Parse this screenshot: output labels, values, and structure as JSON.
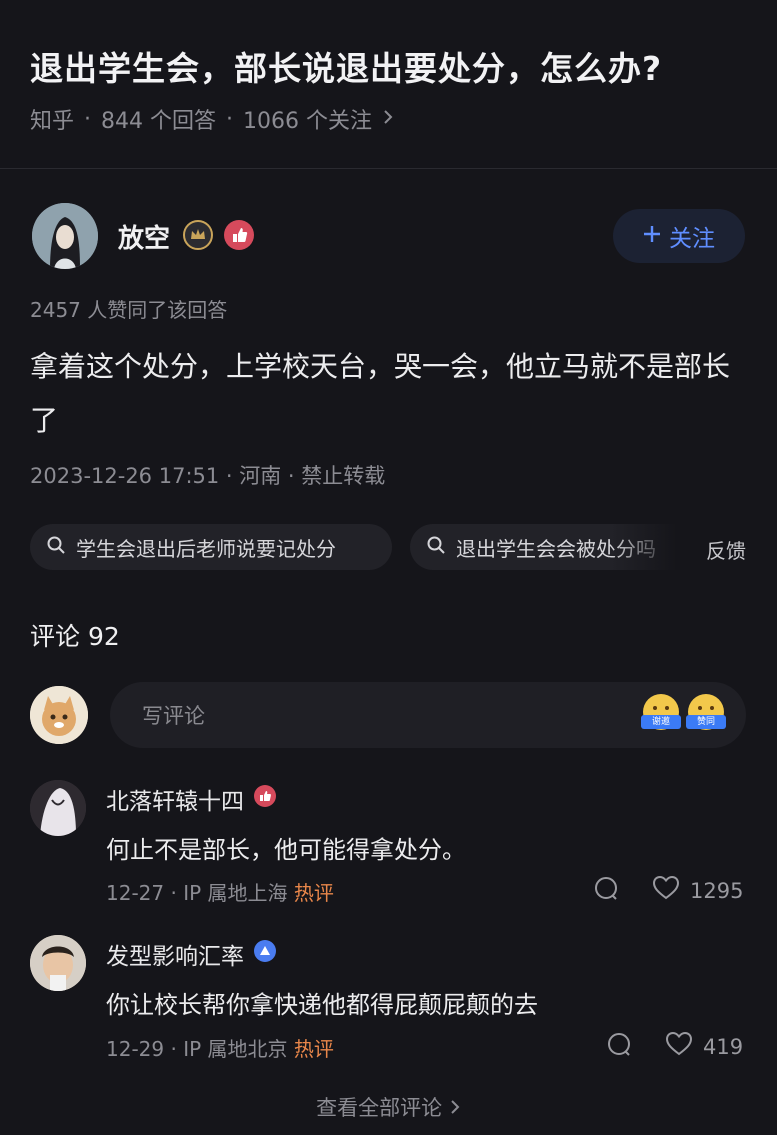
{
  "question": {
    "title": "退出学生会，部长说退出要处分，怎么办?",
    "source": "知乎",
    "answers": "844 个回答",
    "followers": "1066 个关注"
  },
  "answer": {
    "author": "放空",
    "follow_label": "关注",
    "votes": "2457 人赞同了该回答",
    "text": "拿着这个处分，上学校天台，哭一会，他立马就不是部长了",
    "meta": "2023-12-26 17:51 · 河南 · 禁止转载"
  },
  "related": {
    "chips": [
      "学生会退出后老师说要记处分",
      "退出学生会会被处分吗"
    ],
    "feedback": "反馈"
  },
  "comments": {
    "header": "评论 92",
    "input_placeholder": "写评论",
    "emoji_tags": [
      "谢邀",
      "赞同"
    ],
    "items": [
      {
        "name": "北落轩辕十四",
        "text": "何止不是部长，他可能得拿处分。",
        "date": "12-27",
        "ip": "IP 属地上海",
        "tag": "热评",
        "likes": "1295"
      },
      {
        "name": "发型影响汇率",
        "text": "你让校长帮你拿快递他都得屁颠屁颠的去",
        "date": "12-29",
        "ip": "IP 属地北京",
        "tag": "热评",
        "likes": "419"
      }
    ],
    "view_all": "查看全部评论"
  },
  "colors": {
    "background": "#15151a",
    "accent": "#5f8eff",
    "hot": "#e8864a"
  }
}
